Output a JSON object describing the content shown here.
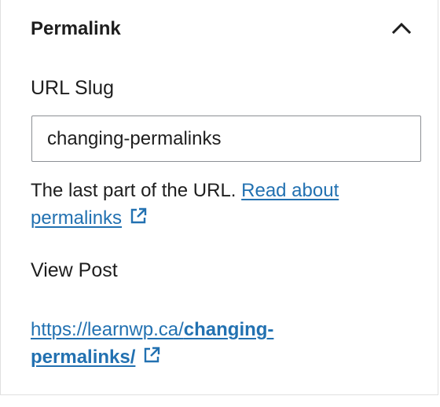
{
  "panel": {
    "title": "Permalink",
    "toggle_icon": "chevron-up-icon"
  },
  "slug": {
    "label": "URL Slug",
    "value": "changing-permalinks"
  },
  "help": {
    "text": "The last part of the URL.",
    "link_part1": "Read about",
    "link_part2": "permalinks",
    "link_icon": "external-link-icon"
  },
  "view_post": {
    "label": "View Post",
    "url_prefix": "https://learnwp.ca/",
    "url_slug_part1": "changing-",
    "url_slug_part2": "permalinks/",
    "link_icon": "external-link-icon"
  },
  "colors": {
    "link": "#2271b1",
    "text": "#1e1e1e",
    "border": "#e0e0e0",
    "input_border": "#8c8f94"
  }
}
